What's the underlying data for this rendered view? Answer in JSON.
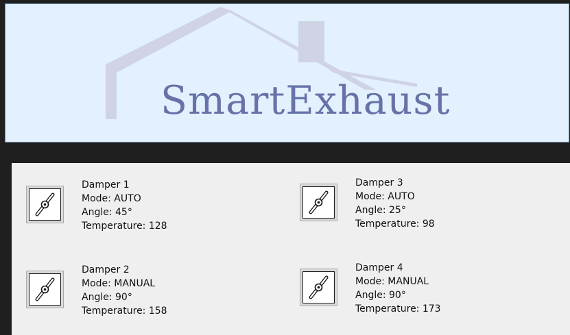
{
  "header": {
    "brand": "SmartExhaust",
    "logo_icon": "house-roof-icon"
  },
  "dampers": [
    {
      "name": "Damper 1",
      "mode": "Mode: AUTO",
      "angle": "Angle: 45°",
      "temperature": "Temperature: 128",
      "icon": "damper-valve-icon"
    },
    {
      "name": "Damper 2",
      "mode": "Mode: MANUAL",
      "angle": "Angle: 90°",
      "temperature": "Temperature: 158",
      "icon": "damper-valve-icon"
    },
    {
      "name": "Damper 3",
      "mode": "Mode: AUTO",
      "angle": "Angle: 25°",
      "temperature": "Temperature: 98",
      "icon": "damper-valve-icon"
    },
    {
      "name": "Damper 4",
      "mode": "Mode: MANUAL",
      "angle": "Angle: 90°",
      "temperature": "Temperature: 173",
      "icon": "damper-valve-icon"
    }
  ],
  "colors": {
    "header_bg": "#e2f1fd",
    "brand_text": "#6672a8",
    "panel_bg": "#efefef",
    "window_bg": "#1f1f1f"
  }
}
